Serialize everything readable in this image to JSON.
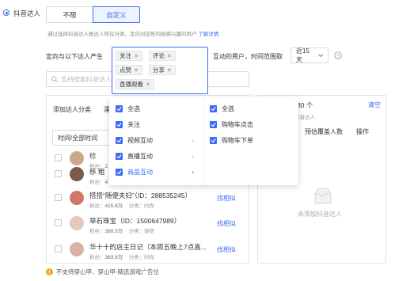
{
  "section": {
    "label": "抖音达人",
    "options": [
      "不限",
      "自定义"
    ],
    "selected": "自定义",
    "hint": "通过选择抖音达人账达人所在分类，定向对这些内容感兴趣的用户",
    "hint_link": "了解详情"
  },
  "targeting": {
    "prefix": "定向与以下达人产生",
    "tags": [
      "关注",
      "评论",
      "点赞",
      "分享",
      "直播观看"
    ],
    "suffix": "互动的用户，时间范围取",
    "time_range": "近15天"
  },
  "search": {
    "placeholder": "支持搜索抖音达人"
  },
  "left_panel": {
    "header": "添加达人分类",
    "header_tab_partial": "濡",
    "time_select": "时间/全部时间",
    "rows": [
      {
        "name": "珍",
        "fans_label": "粉丝：",
        "fans": "2",
        "category": ""
      },
      {
        "name": "移 粗",
        "fans_label": "粉丝：",
        "fans": "4",
        "category": ""
      },
      {
        "name": "搭搭“随便夫妇”（ID：288535245）",
        "fans_label": "粉丝：",
        "fans": "415.8万",
        "category_label": "分类：",
        "category": "时尚",
        "action": "找相似"
      },
      {
        "name": "举石珠宝（ID：1500647989）",
        "fans_label": "粉丝：",
        "fans": "388.5万",
        "category_label": "分类：",
        "category": "穿搭",
        "action": "找相似"
      },
      {
        "name": "华十十的店主日记（本周五晚上7点直...",
        "fans_label": "粉丝：",
        "fans": "383.9万",
        "category_label": "分类：",
        "category": "时尚",
        "action": "找相似"
      }
    ]
  },
  "right_panel": {
    "count": "30 个",
    "count_sub": "抖音达人",
    "clear": "清空",
    "col_reach": "预估覆盖人数",
    "col_action": "操作",
    "empty": "未添加抖音达人"
  },
  "dropdown": {
    "col1": [
      "全选",
      "关注",
      "视频互动",
      "直播互动",
      "商品互动"
    ],
    "col1_checked": [
      true,
      true,
      true,
      true,
      true
    ],
    "col2": [
      "全选",
      "购物车点击",
      "购物车下单"
    ]
  },
  "footer_note": "不支持穿山甲、穿山甲-精选游戏广告位",
  "colors": {
    "accent": "#3b6cf6",
    "warning": "#f5a623"
  }
}
